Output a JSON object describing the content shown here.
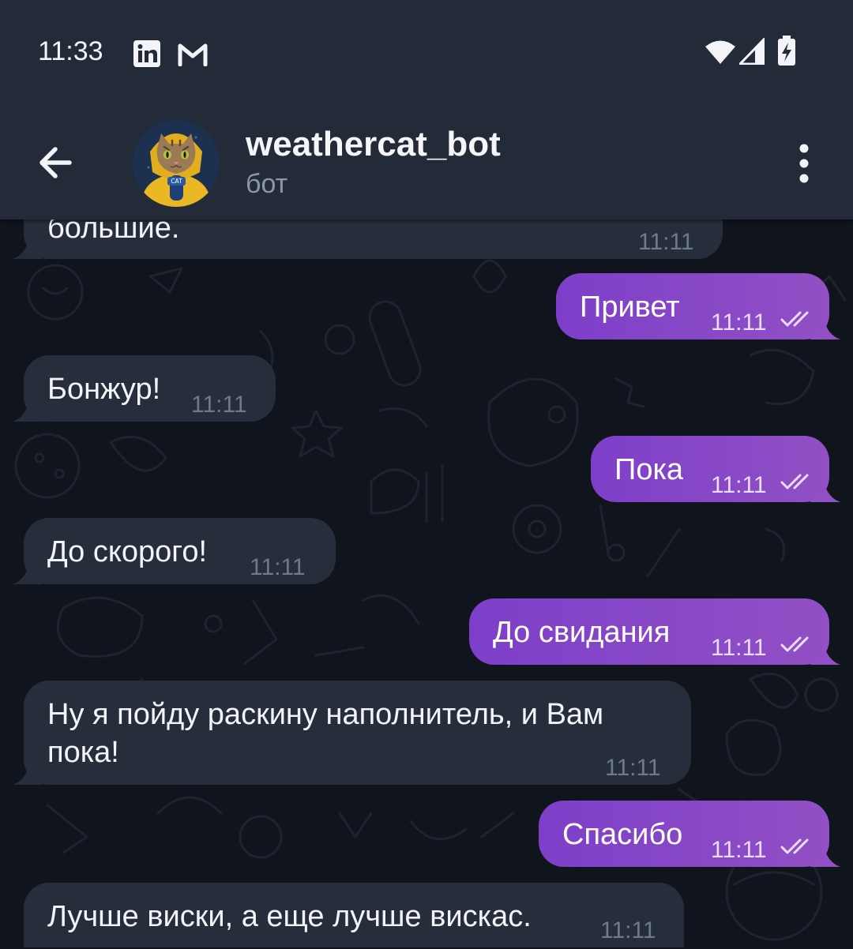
{
  "status_bar": {
    "time": "11:33",
    "notification_icons": [
      "linkedin-icon",
      "gmail-icon"
    ],
    "system_icons": [
      "wifi-icon",
      "signal-icon",
      "battery-charging-icon"
    ]
  },
  "header": {
    "back_icon": "arrow-left-icon",
    "avatar_label": "CAT",
    "title": "weathercat_bot",
    "subtitle": "бот",
    "menu_icon": "more-vert-icon"
  },
  "messages": [
    {
      "direction": "in",
      "text": "большие.",
      "time": "11:11"
    },
    {
      "direction": "out",
      "text": "Привет",
      "time": "11:11",
      "status": "read"
    },
    {
      "direction": "in",
      "text": "Бонжур!",
      "time": "11:11"
    },
    {
      "direction": "out",
      "text": "Пока",
      "time": "11:11",
      "status": "read"
    },
    {
      "direction": "in",
      "text": "До скорого!",
      "time": "11:11"
    },
    {
      "direction": "out",
      "text": "До свидания",
      "time": "11:11",
      "status": "read"
    },
    {
      "direction": "in",
      "lines": [
        "Ну я пойду раскину наполнитель, и Вам",
        "пока!"
      ],
      "time": "11:11"
    },
    {
      "direction": "out",
      "text": "Спасибо",
      "time": "11:11",
      "status": "read"
    },
    {
      "direction": "in",
      "text": "Лучше виски, а еще лучше вискас.",
      "time": "11:11"
    }
  ],
  "colors": {
    "background": "#10141c",
    "header": "#232b38",
    "incoming_bubble": "#262d3b",
    "outgoing_bubble": "#8a48c6"
  }
}
